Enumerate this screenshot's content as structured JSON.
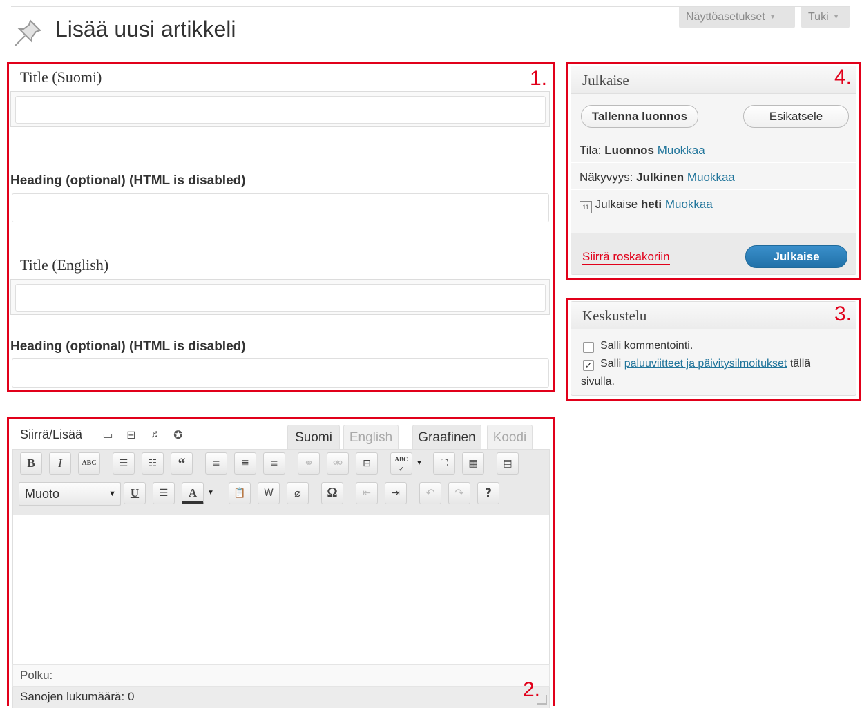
{
  "header": {
    "title": "Lisää uusi artikkeli",
    "screen_options": "Näyttöasetukset",
    "help": "Tuki",
    "page_icon": "pushpin-icon"
  },
  "markers": {
    "box1": "1.",
    "box2": "2.",
    "box3": "3.",
    "box4": "4."
  },
  "title_box": {
    "title_fi_label": "Title (Suomi)",
    "title_fi_value": "",
    "heading_fi_label": "Heading (optional) (HTML is disabled)",
    "heading_fi_value": "",
    "title_en_label": "Title (English)",
    "title_en_value": "",
    "heading_en_label": "Heading (optional) (HTML is disabled)",
    "heading_en_value": ""
  },
  "publish_box": {
    "title": "Julkaise",
    "save_draft": "Tallenna luonnos",
    "preview": "Esikatsele",
    "status_label": "Tila:",
    "status_value": "Luonnos",
    "visibility_label": "Näkyvyys:",
    "visibility_value": "Julkinen",
    "publish_label": "Julkaise",
    "publish_value": "heti",
    "edit_link": "Muokkaa",
    "trash_link": "Siirrä roskakoriin",
    "publish_button": "Julkaise"
  },
  "discussion_box": {
    "title": "Keskustelu",
    "allow_comments": "Salli kommentointi.",
    "allow_comments_checked": false,
    "allow_pings_prefix": "Salli",
    "allow_pings_link": "paluuviitteet ja päivitysilmoitukset",
    "allow_pings_suffix": "tällä",
    "allow_pings_suffix2": "sivulla.",
    "allow_pings_checked": true
  },
  "editor": {
    "media_label": "Siirrä/Lisää",
    "lang_tabs": [
      "Suomi",
      "English"
    ],
    "mode_tabs": [
      "Graafinen",
      "Koodi"
    ],
    "format_select": "Muoto",
    "path_label": "Polku:",
    "word_count_label": "Sanojen lukumäärä:",
    "word_count": "0",
    "toolbar_row1": [
      "bold-icon",
      "italic-icon",
      "strikethrough-icon",
      "bullet-list-icon",
      "numbered-list-icon",
      "blockquote-icon",
      "align-left-icon",
      "align-center-icon",
      "align-right-icon",
      "link-icon",
      "unlink-icon",
      "more-tag-icon",
      "spellcheck-icon",
      "fullscreen-icon",
      "kitchen-sink-icon",
      "page-break-icon"
    ],
    "toolbar_row2": [
      "underline-icon",
      "justify-icon",
      "text-color-icon",
      "paste-text-icon",
      "paste-word-icon",
      "clear-formatting-icon",
      "special-char-icon",
      "outdent-icon",
      "indent-icon",
      "undo-icon",
      "redo-icon",
      "help-icon"
    ]
  },
  "colors": {
    "highlight": "#e1001a",
    "link": "#21759b",
    "primary_button": "#2a7bb5"
  }
}
